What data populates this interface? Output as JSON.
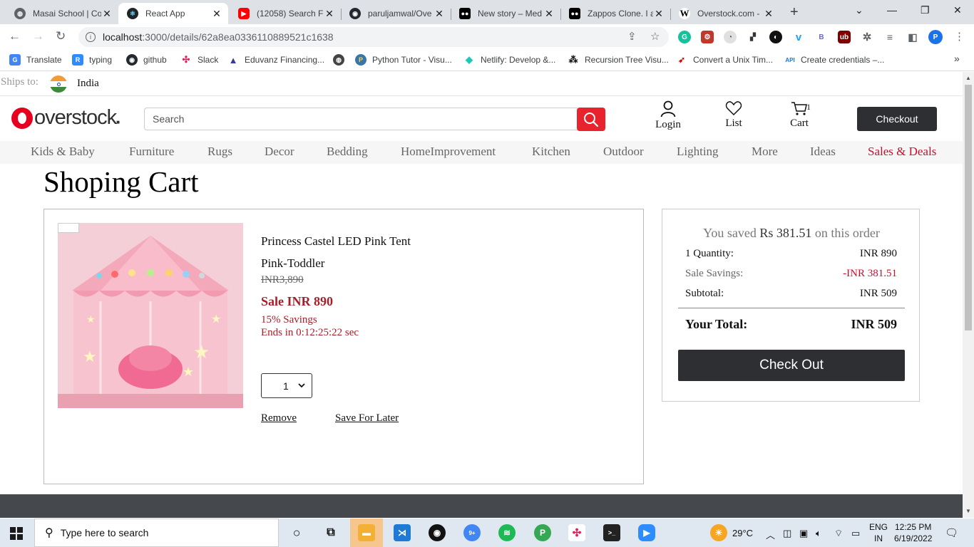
{
  "browser": {
    "tabs": [
      {
        "title": "Masai School | Co",
        "icon": "globe-icon"
      },
      {
        "title": "React App",
        "icon": "react-icon",
        "active": true
      },
      {
        "title": "(12058) Search Fi",
        "icon": "youtube-icon"
      },
      {
        "title": "paruljamwal/Ove",
        "icon": "github-icon"
      },
      {
        "title": "New story – Med",
        "icon": "medium-icon"
      },
      {
        "title": "Zappos Clone. I a",
        "icon": "medium-icon"
      },
      {
        "title": "Overstock.com -",
        "icon": "wikipedia-icon"
      }
    ],
    "url_host": "localhost",
    "url_path": ":3000/details/62a8ea0336110889521c1638",
    "profile_initial": "P",
    "bookmarks": [
      {
        "label": "Translate",
        "icon": "google-translate-icon"
      },
      {
        "label": "typing",
        "icon": "typing-icon"
      },
      {
        "label": "github",
        "icon": "github-icon"
      },
      {
        "label": "Slack",
        "icon": "slack-icon"
      },
      {
        "label": "Eduvanz Financing...",
        "icon": "eduvanz-icon"
      },
      {
        "label": "",
        "icon": "globe-icon"
      },
      {
        "label": "Python Tutor - Visu...",
        "icon": "python-icon"
      },
      {
        "label": "Netlify: Develop &...",
        "icon": "netlify-icon"
      },
      {
        "label": "Recursion Tree Visu...",
        "icon": "tree-icon"
      },
      {
        "label": "Convert a Unix Tim...",
        "icon": "rocket-icon"
      },
      {
        "label": "Create credentials –...",
        "icon": "api-icon"
      }
    ],
    "api_badge": "API",
    "more_bookmarks": "»"
  },
  "site": {
    "ships_to_label": "Ships to:",
    "country": "India",
    "logo_text": "overstock",
    "search_placeholder": "Search",
    "login_label": "Login",
    "list_label": "List",
    "cart_label": "Cart",
    "cart_count": "1",
    "checkout_label": "Checkout",
    "nav": [
      "Kids & Baby",
      "Furniture",
      "Rugs",
      "Decor",
      "Bedding",
      "HomeImprovement",
      "Kitchen",
      "Outdoor",
      "Lighting",
      "More",
      "Ideas",
      "Sales & Deals"
    ],
    "brand_color": "#e8232d"
  },
  "cart": {
    "title": "Shoping Cart",
    "item": {
      "name_line1": "Princess Castel LED Pink Tent",
      "name_line2": "Pink-Toddler",
      "old_price": "INR3,890",
      "sale_price": "Sale INR 890",
      "savings": "15% Savings",
      "ends": "Ends in 0:12:25:22 sec",
      "quantity": "1",
      "remove_label": "Remove",
      "save_later_label": "Save For Later"
    },
    "summary": {
      "saved_prefix": "You saved",
      "saved_amount": "Rs 381.51",
      "saved_suffix": "on this order",
      "quantity_label": "1 Quantity:",
      "quantity_value": "INR 890",
      "savings_label": "Sale Savings:",
      "savings_value": "-INR 381.51",
      "subtotal_label": "Subtotal:",
      "subtotal_value": "INR 509",
      "total_label": "Your Total:",
      "total_value": "INR 509",
      "checkout_label": "Check Out"
    }
  },
  "taskbar": {
    "search_placeholder": "Type here to search",
    "weather": "29°C",
    "lang_line1": "ENG",
    "lang_line2": "IN",
    "time": "12:25 PM",
    "date": "6/19/2022",
    "chrome_badge": "9+"
  }
}
